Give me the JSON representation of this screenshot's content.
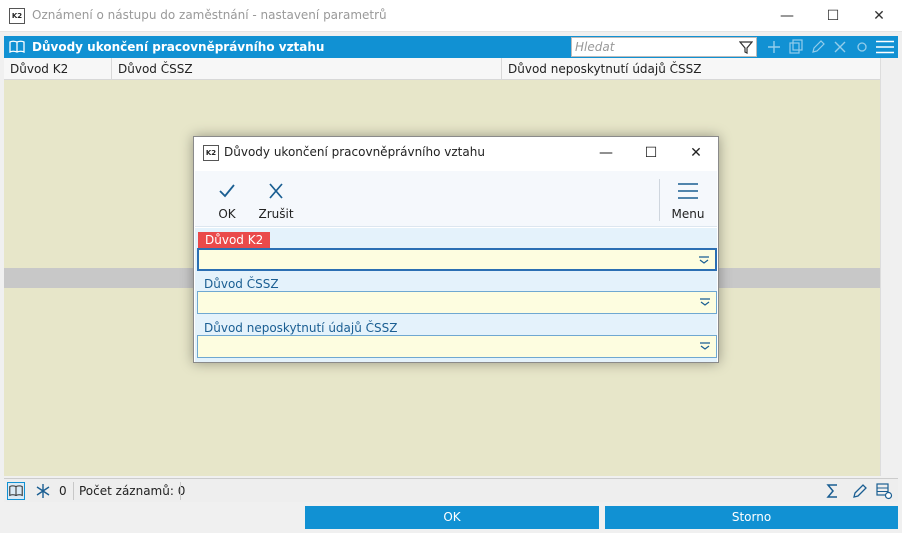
{
  "window": {
    "title": "Oznámení o nástupu do zaměstnání - nastavení parametrů",
    "app_icon_text": "K2",
    "controls": {
      "minimize": "—",
      "maximize": "☐",
      "close": "✕"
    }
  },
  "panel": {
    "title": "Důvody ukončení pracovněprávního vztahu",
    "search_placeholder": "Hledat",
    "icons": [
      "book-icon",
      "filter-icon",
      "menu-icon"
    ]
  },
  "grid": {
    "columns": [
      "Důvod K2",
      "Důvod ČSSZ",
      "Důvod neposkytnutí údajů ČSSZ"
    ]
  },
  "statusbar": {
    "count_value": "0",
    "records_label": "Počet záznamů: 0"
  },
  "bottom_buttons": {
    "ok": "OK",
    "storno": "Storno"
  },
  "dialog": {
    "title": "Důvody ukončení pracovněprávního vztahu",
    "app_icon_text": "K2",
    "controls": {
      "minimize": "—",
      "maximize": "☐",
      "close": "✕"
    },
    "toolbar": {
      "ok": "OK",
      "cancel": "Zrušit",
      "menu": "Menu"
    },
    "fields": [
      {
        "label": "Důvod K2",
        "value": "",
        "required": true
      },
      {
        "label": "Důvod ČSSZ",
        "value": "",
        "required": false
      },
      {
        "label": "Důvod neposkytnutí údajů ČSSZ",
        "value": "",
        "required": false
      }
    ]
  },
  "colors": {
    "accent": "#1191d3",
    "grid_bg": "#e7e6c9",
    "required": "#ea4a4a",
    "field_bg": "#fdfde0",
    "form_bg": "#e4f2fb"
  }
}
